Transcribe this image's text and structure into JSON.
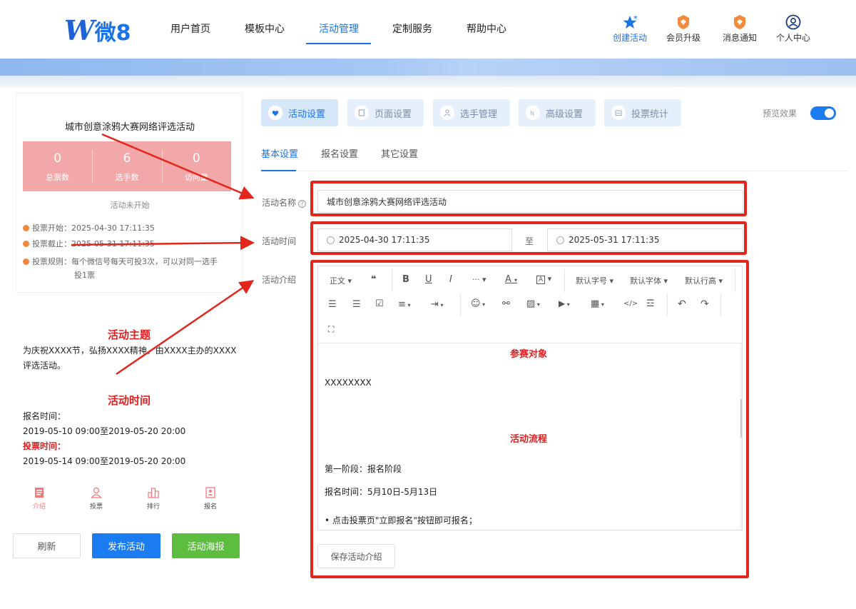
{
  "logo": {
    "w": "W",
    "text": "微8"
  },
  "nav": [
    {
      "label": "用户首页"
    },
    {
      "label": "模板中心"
    },
    {
      "label": "活动管理"
    },
    {
      "label": "定制服务"
    },
    {
      "label": "帮助中心"
    }
  ],
  "header_icons": [
    {
      "label": "创建活动",
      "icon": "star-create-icon"
    },
    {
      "label": "会员升级",
      "icon": "vip-badge-icon"
    },
    {
      "label": "消息通知",
      "icon": "message-badge-icon"
    },
    {
      "label": "个人中心",
      "icon": "user-icon"
    }
  ],
  "preview": {
    "title": "城市创意涂鸦大赛网络评选活动",
    "stats": [
      {
        "num": "0",
        "label": "总票数"
      },
      {
        "num": "6",
        "label": "选手数"
      },
      {
        "num": "0",
        "label": "访问量"
      }
    ],
    "status": "活动未开始",
    "vote_start": "投票开始：2025-04-30 17:11:35",
    "vote_end": "投票截止：2025-05-31 17:11:35",
    "rule_line1": "投票规则：每个微信号每天可投3次，可以对同一选手",
    "rule_line2": "投1票",
    "theme_heading": "活动主题",
    "theme_text": "为庆祝XXXX节，弘扬XXXX精神，由XXXX主办的XXXX评选活动。",
    "time_heading": "活动时间",
    "signup_label": "报名时间：",
    "signup_time": "2019-05-10 09:00至2019-05-20 20:00",
    "vote_label": "投票时间：",
    "vote_time": "2019-05-14 09:00至2019-05-20 20:00",
    "tabbar": [
      {
        "label": "介绍",
        "icon": "intro-icon"
      },
      {
        "label": "投票",
        "icon": "vote-user-icon"
      },
      {
        "label": "排行",
        "icon": "rank-icon"
      },
      {
        "label": "报名",
        "icon": "signup-icon"
      }
    ]
  },
  "actions": {
    "refresh": "刷新",
    "publish": "发布活动",
    "poster": "活动海报"
  },
  "tabs": [
    {
      "label": "活动设置"
    },
    {
      "label": "页面设置"
    },
    {
      "label": "选手管理"
    },
    {
      "label": "高级设置"
    },
    {
      "label": "投票统计"
    }
  ],
  "preview_toggle": {
    "label": "预览效果",
    "on": true
  },
  "subtabs": [
    {
      "label": "基本设置"
    },
    {
      "label": "报名设置"
    },
    {
      "label": "其它设置"
    }
  ],
  "form": {
    "name_label": "活动名称",
    "name_value": "城市创意涂鸦大赛网络评选活动",
    "time_label": "活动时间",
    "start": "2025-04-30 17:11:35",
    "to": "至",
    "end": "2025-05-31 17:11:35",
    "intro_label": "活动介绍"
  },
  "toolbar": {
    "paragraph": "正文",
    "quote": "❝",
    "bold": "B",
    "underline": "U",
    "italic": "I",
    "more": "···",
    "font_color": "A",
    "bg_color": "A",
    "font_size": "默认字号",
    "font_family": "默认字体",
    "line_height": "默认行高"
  },
  "editor": {
    "h1": "参赛对象",
    "p1": "XXXXXXXX",
    "h2": "活动流程",
    "p2": "第一阶段：报名阶段",
    "p3": "报名时间：5月10日-5月13日",
    "p4": "• 点击投票页\"立即报名\"按钮即可报名；"
  },
  "save_button": "保存活动介绍",
  "colors": {
    "accent": "#1a73e8",
    "annotation": "#e3261c",
    "stats_bg": "#f2a8a8"
  }
}
